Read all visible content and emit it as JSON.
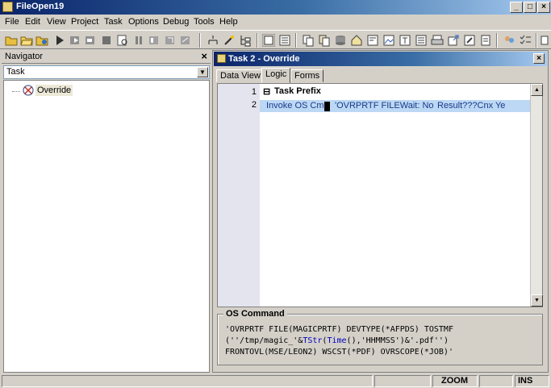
{
  "window": {
    "title": "FileOpen19"
  },
  "menu": [
    "File",
    "Edit",
    "View",
    "Project",
    "Task",
    "Options",
    "Debug",
    "Tools",
    "Help"
  ],
  "navigator": {
    "title": "Navigator",
    "select_value": "Task",
    "tree_items": [
      {
        "label": "Override"
      }
    ]
  },
  "task_window": {
    "title": "Task 2 -  Override",
    "tabs": [
      "Data View",
      "Logic",
      "Forms"
    ],
    "active_tab": "Logic",
    "rows": [
      {
        "num": "1",
        "parts": [
          "Task  Prefix"
        ]
      },
      {
        "num": "2",
        "parts": [
          "Invoke OS Cmd",
          "'OVRPRTF FILEWait: No",
          "Result???Cnx Ye"
        ]
      }
    ]
  },
  "os_command": {
    "legend": "OS Command",
    "line1": "'OVRPRTF FILE(MAGICPRTF) DEVTYPE(*AFPDS) TOSTMF",
    "line2_a": "(''/tmp/magic_'&",
    "line2_b": "TStr",
    "line2_c": "(",
    "line2_d": "Time",
    "line2_e": "(),'HHMMSS')&'.pdf'')",
    "line3": "FRONTOVL(MSE/LEON2) WSCST(*PDF) OVRSCOPE(*JOB)'"
  },
  "statusbar": {
    "zoom": "ZOOM",
    "ins": "INS"
  },
  "colors": {
    "title_gradient_start": "#0a246a",
    "selection_row": "#bcd8f4",
    "keyword": "#0000c0"
  }
}
